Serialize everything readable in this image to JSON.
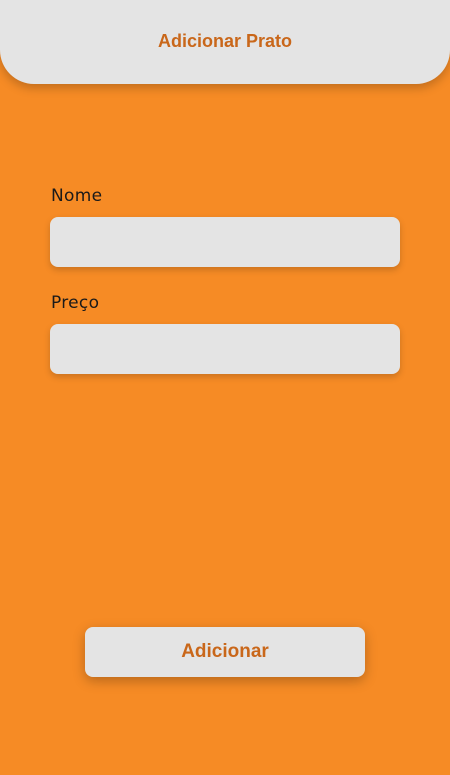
{
  "header": {
    "title": "Adicionar Prato"
  },
  "form": {
    "name_label": "Nome",
    "name_value": "",
    "price_label": "Preço",
    "price_value": ""
  },
  "actions": {
    "add_label": "Adicionar"
  },
  "colors": {
    "background": "#F68B25",
    "surface": "#E4E4E4",
    "accent_text": "#C9671A"
  }
}
